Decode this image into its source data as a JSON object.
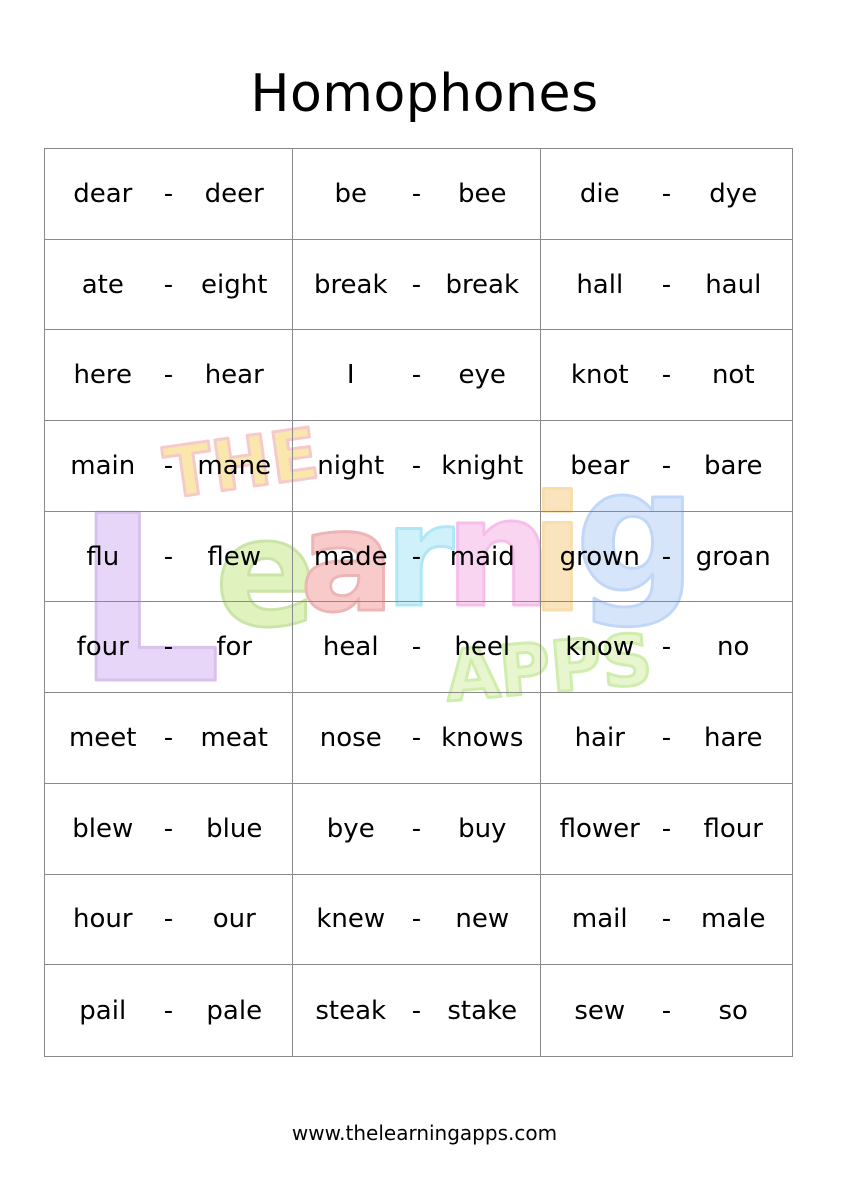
{
  "title": "Homophones",
  "separator": "-",
  "watermark": {
    "line1": "THE",
    "line2": "Learning",
    "line3": "APPS",
    "colors": [
      "#c9a0ee",
      "#f7d46a",
      "#f07a7a",
      "#6fd4f0",
      "#f08ad8",
      "#f5c36b",
      "#8fb8f5",
      "#a8e06a"
    ]
  },
  "rows": [
    [
      [
        "dear",
        "deer"
      ],
      [
        "be",
        "bee"
      ],
      [
        "die",
        "dye"
      ]
    ],
    [
      [
        "ate",
        "eight"
      ],
      [
        "break",
        "break"
      ],
      [
        "hall",
        "haul"
      ]
    ],
    [
      [
        "here",
        "hear"
      ],
      [
        "I",
        "eye"
      ],
      [
        "knot",
        "not"
      ]
    ],
    [
      [
        "main",
        "mane"
      ],
      [
        "night",
        "knight"
      ],
      [
        "bear",
        "bare"
      ]
    ],
    [
      [
        "flu",
        "flew"
      ],
      [
        "made",
        "maid"
      ],
      [
        "grown",
        "groan"
      ]
    ],
    [
      [
        "four",
        "for"
      ],
      [
        "heal",
        "heel"
      ],
      [
        "know",
        "no"
      ]
    ],
    [
      [
        "meet",
        "meat"
      ],
      [
        "nose",
        "knows"
      ],
      [
        "hair",
        "hare"
      ]
    ],
    [
      [
        "blew",
        "blue"
      ],
      [
        "bye",
        "buy"
      ],
      [
        "flower",
        "flour"
      ]
    ],
    [
      [
        "hour",
        "our"
      ],
      [
        "knew",
        "new"
      ],
      [
        "mail",
        "male"
      ]
    ],
    [
      [
        "pail",
        "pale"
      ],
      [
        "steak",
        "stake"
      ],
      [
        "sew",
        "so"
      ]
    ]
  ],
  "footer": "www.thelearningapps.com"
}
